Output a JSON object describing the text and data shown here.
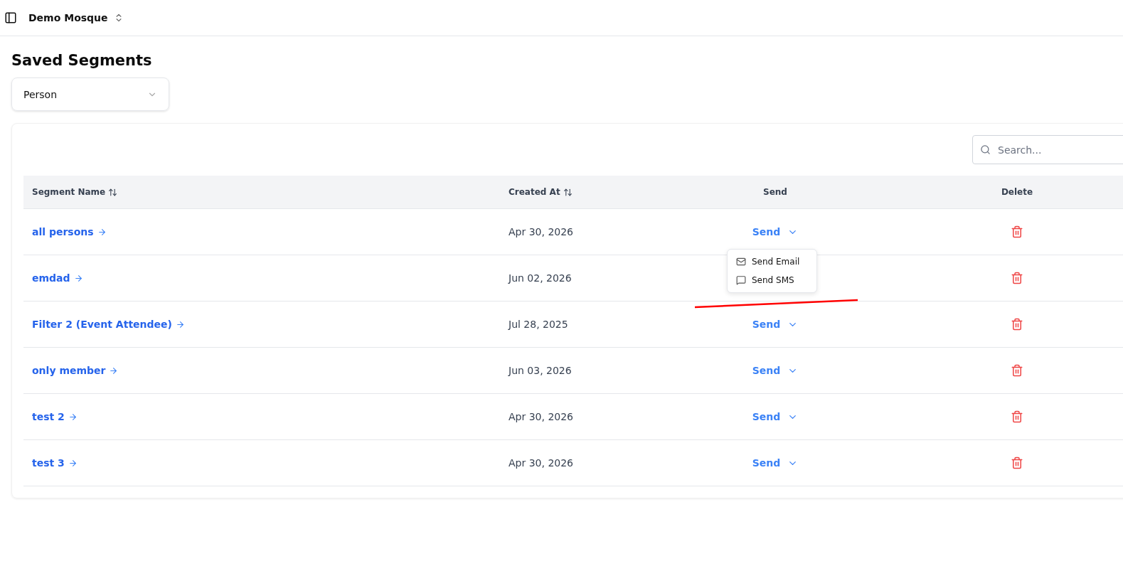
{
  "header": {
    "workspace": "Demo Mosque"
  },
  "page": {
    "title": "Saved Segments"
  },
  "filter": {
    "value": "Person"
  },
  "search": {
    "placeholder": "Search..."
  },
  "table": {
    "columns": [
      {
        "label": "Segment Name",
        "sortable": true
      },
      {
        "label": "Created At",
        "sortable": true
      },
      {
        "label": "Send",
        "sortable": false
      },
      {
        "label": "Delete",
        "sortable": false
      }
    ],
    "rows": [
      {
        "name": "all persons",
        "created_at": "Apr 30, 2026",
        "send": "Send"
      },
      {
        "name": "emdad",
        "created_at": "Jun 02, 2026"
      },
      {
        "name": "Filter 2 (Event Attendee)",
        "created_at": "Jul 28, 2025",
        "send": "Send"
      },
      {
        "name": "only member",
        "created_at": "Jun 03, 2026",
        "send": "Send"
      },
      {
        "name": "test 2",
        "created_at": "Apr 30, 2026",
        "send": "Send"
      },
      {
        "name": "test 3",
        "created_at": "Apr 30, 2026",
        "send": "Send"
      }
    ]
  },
  "send_menu": [
    {
      "kind": "email",
      "label": "Send Email"
    },
    {
      "kind": "sms",
      "label": "Send SMS"
    }
  ],
  "annotation": {
    "kind": "underline"
  }
}
